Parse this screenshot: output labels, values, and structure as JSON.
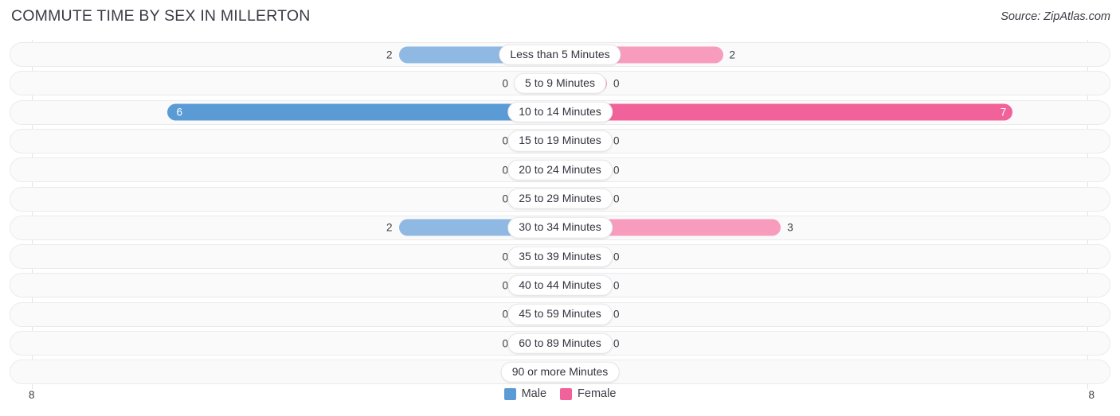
{
  "header": {
    "title": "COMMUTE TIME BY SEX IN MILLERTON",
    "source": "Source: ZipAtlas.com"
  },
  "axis": {
    "left_max_label": "8",
    "right_max_label": "8"
  },
  "legend": {
    "items": [
      {
        "label": "Male",
        "color": "#5b9bd5"
      },
      {
        "label": "Female",
        "color": "#f2629a"
      }
    ]
  },
  "colors": {
    "male": "#8fb9e3",
    "male_peak": "#5b9bd5",
    "female": "#f79cbd",
    "female_peak": "#f2629a",
    "track": "#fafafa",
    "track_border": "#ebebed"
  },
  "chart_data": {
    "type": "bar",
    "subtype": "diverging-bidirectional-bar",
    "title": "COMMUTE TIME BY SEX IN MILLERTON",
    "xlabel": "",
    "ylabel": "",
    "xlim": [
      8,
      8
    ],
    "axis_max": 8,
    "grid": false,
    "legend_position": "bottom-center",
    "categories": [
      "Less than 5 Minutes",
      "5 to 9 Minutes",
      "10 to 14 Minutes",
      "15 to 19 Minutes",
      "20 to 24 Minutes",
      "25 to 29 Minutes",
      "30 to 34 Minutes",
      "35 to 39 Minutes",
      "40 to 44 Minutes",
      "45 to 59 Minutes",
      "60 to 89 Minutes",
      "90 or more Minutes"
    ],
    "series": [
      {
        "name": "Male",
        "direction": "left",
        "values": [
          2,
          0,
          6,
          0,
          0,
          0,
          2,
          0,
          0,
          0,
          0,
          0
        ]
      },
      {
        "name": "Female",
        "direction": "right",
        "values": [
          2,
          0,
          7,
          0,
          0,
          0,
          3,
          0,
          0,
          0,
          0,
          0
        ]
      }
    ]
  },
  "rows": [
    {
      "label": "Less than 5 Minutes",
      "male": "2",
      "female": "2",
      "male_peak": false,
      "female_peak": false
    },
    {
      "label": "5 to 9 Minutes",
      "male": "0",
      "female": "0",
      "male_peak": false,
      "female_peak": false
    },
    {
      "label": "10 to 14 Minutes",
      "male": "6",
      "female": "7",
      "male_peak": true,
      "female_peak": true
    },
    {
      "label": "15 to 19 Minutes",
      "male": "0",
      "female": "0",
      "male_peak": false,
      "female_peak": false
    },
    {
      "label": "20 to 24 Minutes",
      "male": "0",
      "female": "0",
      "male_peak": false,
      "female_peak": false
    },
    {
      "label": "25 to 29 Minutes",
      "male": "0",
      "female": "0",
      "male_peak": false,
      "female_peak": false
    },
    {
      "label": "30 to 34 Minutes",
      "male": "2",
      "female": "3",
      "male_peak": false,
      "female_peak": false
    },
    {
      "label": "35 to 39 Minutes",
      "male": "0",
      "female": "0",
      "male_peak": false,
      "female_peak": false
    },
    {
      "label": "40 to 44 Minutes",
      "male": "0",
      "female": "0",
      "male_peak": false,
      "female_peak": false
    },
    {
      "label": "45 to 59 Minutes",
      "male": "0",
      "female": "0",
      "male_peak": false,
      "female_peak": false
    },
    {
      "label": "60 to 89 Minutes",
      "male": "0",
      "female": "0",
      "male_peak": false,
      "female_peak": false
    },
    {
      "label": "90 or more Minutes",
      "male": "0",
      "female": "0",
      "male_peak": false,
      "female_peak": false
    }
  ]
}
